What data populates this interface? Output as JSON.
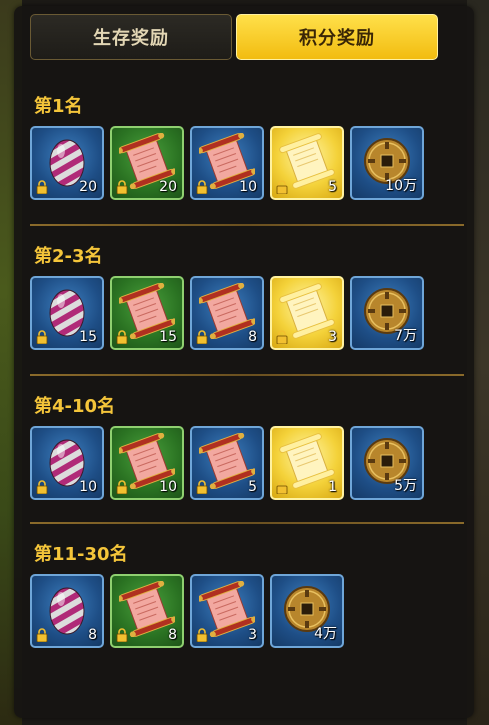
{
  "tabs": [
    {
      "label": "生存奖励",
      "active": false
    },
    {
      "label": "积分奖励",
      "active": true
    }
  ],
  "colors": {
    "accent_gold": "#f4c53a",
    "tab_active": "#f2bc10",
    "frame_blue": "#1e4e86",
    "frame_green": "#2a7222",
    "frame_gold": "#f4d23a"
  },
  "sections": [
    {
      "title": "第1名",
      "items": [
        {
          "icon": "striped-egg-icon",
          "frame": "blue",
          "qty": "20",
          "locked": true
        },
        {
          "icon": "scroll-icon",
          "frame": "green",
          "qty": "20",
          "locked": true
        },
        {
          "icon": "scroll-icon",
          "frame": "blue",
          "qty": "10",
          "locked": true
        },
        {
          "icon": "golden-scroll-icon",
          "frame": "gold",
          "qty": "5",
          "locked": true
        },
        {
          "icon": "copper-coin-icon",
          "frame": "blue",
          "qty": "10万",
          "locked": false
        }
      ]
    },
    {
      "title": "第2-3名",
      "items": [
        {
          "icon": "striped-egg-icon",
          "frame": "blue",
          "qty": "15",
          "locked": true
        },
        {
          "icon": "scroll-icon",
          "frame": "green",
          "qty": "15",
          "locked": true
        },
        {
          "icon": "scroll-icon",
          "frame": "blue",
          "qty": "8",
          "locked": true
        },
        {
          "icon": "golden-scroll-icon",
          "frame": "gold",
          "qty": "3",
          "locked": true
        },
        {
          "icon": "copper-coin-icon",
          "frame": "blue",
          "qty": "7万",
          "locked": false
        }
      ]
    },
    {
      "title": "第4-10名",
      "items": [
        {
          "icon": "striped-egg-icon",
          "frame": "blue",
          "qty": "10",
          "locked": true
        },
        {
          "icon": "scroll-icon",
          "frame": "green",
          "qty": "10",
          "locked": true
        },
        {
          "icon": "scroll-icon",
          "frame": "blue",
          "qty": "5",
          "locked": true
        },
        {
          "icon": "golden-scroll-icon",
          "frame": "gold",
          "qty": "1",
          "locked": true
        },
        {
          "icon": "copper-coin-icon",
          "frame": "blue",
          "qty": "5万",
          "locked": false
        }
      ]
    },
    {
      "title": "第11-30名",
      "items": [
        {
          "icon": "striped-egg-icon",
          "frame": "blue",
          "qty": "8",
          "locked": true
        },
        {
          "icon": "scroll-icon",
          "frame": "green",
          "qty": "8",
          "locked": true
        },
        {
          "icon": "scroll-icon",
          "frame": "blue",
          "qty": "3",
          "locked": true
        },
        {
          "icon": "copper-coin-icon",
          "frame": "blue",
          "qty": "4万",
          "locked": false
        }
      ]
    }
  ]
}
